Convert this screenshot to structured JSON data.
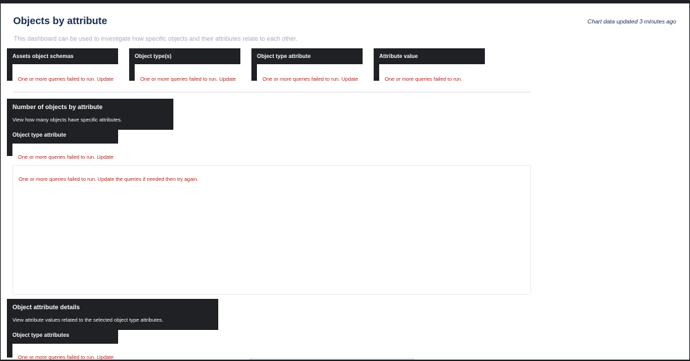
{
  "header": {
    "title": "Objects by attribute",
    "updated": "Chart data updated 3 minutes ago",
    "description": "This dashboard can be used to investigate how specific objects and their attributes relate to each other."
  },
  "filters": [
    {
      "label": "Assets object schemas",
      "error": "One or more queries failed to run.",
      "action": "Update"
    },
    {
      "label": "Object type(s)",
      "error": "One or more queries failed to run.",
      "action": "Update"
    },
    {
      "label": "Object type attribute",
      "error": "One or more queries failed to run.",
      "action": "Update"
    },
    {
      "label": "Attribute value",
      "error": "One or more queries failed to run."
    }
  ],
  "section1": {
    "title": "Number of objects by attribute",
    "description": "View how many objects have specific attributes.",
    "filter_label": "Object type attribute",
    "filter_error": "One or more queries failed to run.",
    "filter_action": "Update",
    "chart_error": "One or more queries failed to run.",
    "chart_action": "Update",
    "chart_error_tail": "the queries if needed then try again."
  },
  "section2": {
    "title": "Object attribute details",
    "description": "View attribute values related to the selected object type attributes.",
    "filter_label": "Object type attributes",
    "filter_error": "One or more queries failed to run.",
    "filter_action": "Update"
  },
  "colors": {
    "dark": "#202124",
    "error": "#b3261e",
    "title": "#172b4d",
    "muted": "#a5adba"
  }
}
